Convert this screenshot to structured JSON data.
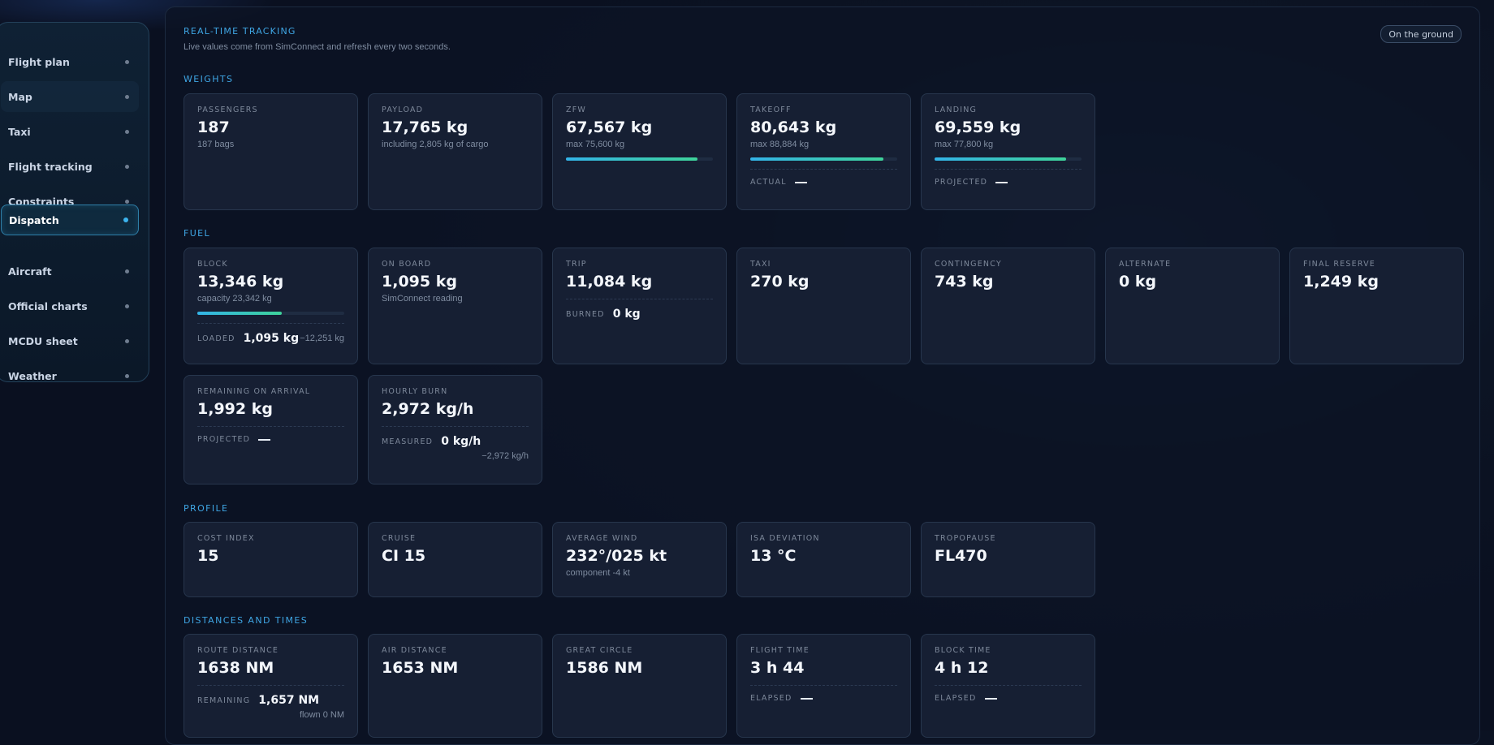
{
  "sidebar": {
    "items": [
      {
        "label": "Flight plan"
      },
      {
        "label": "Map"
      },
      {
        "label": "Taxi"
      },
      {
        "label": "Flight tracking"
      },
      {
        "label": "Constraints"
      },
      {
        "label": "Dispatch"
      },
      {
        "label": "Aircraft"
      },
      {
        "label": "Official charts"
      },
      {
        "label": "MCDU sheet"
      },
      {
        "label": "Weather"
      }
    ],
    "active": "Dispatch"
  },
  "header": {
    "title": "REAL-TIME TRACKING",
    "subtitle": "Live values come from SimConnect and refresh every two seconds.",
    "status": "On the ground"
  },
  "sections": {
    "weights": {
      "title": "WEIGHTS",
      "passengers": {
        "label": "PASSENGERS",
        "value": "187",
        "sub": "187 bags"
      },
      "payload": {
        "label": "PAYLOAD",
        "value": "17,765 kg",
        "sub": "including 2,805 kg of cargo"
      },
      "zfw": {
        "label": "ZFW",
        "value": "67,567 kg",
        "sub": "max 75,600 kg",
        "fill": 0.894
      },
      "takeoff": {
        "label": "TAKEOFF",
        "value": "80,643 kg",
        "sub": "max 88,884 kg",
        "fill": 0.907,
        "foot_label": "ACTUAL"
      },
      "landing": {
        "label": "LANDING",
        "value": "69,559 kg",
        "sub": "max 77,800 kg",
        "fill": 0.894,
        "foot_label": "PROJECTED"
      }
    },
    "fuel": {
      "title": "FUEL",
      "block": {
        "label": "BLOCK",
        "value": "13,346 kg",
        "sub": "capacity 23,342 kg",
        "fill": 0.572,
        "foot_label": "LOADED",
        "foot_value": "1,095 kg",
        "foot_extra": "−12,251 kg"
      },
      "on_board": {
        "label": "ON BOARD",
        "value": "1,095 kg",
        "sub": "SimConnect reading"
      },
      "trip": {
        "label": "TRIP",
        "value": "11,084 kg",
        "foot_label": "BURNED",
        "foot_value": "0 kg"
      },
      "taxi": {
        "label": "TAXI",
        "value": "270 kg"
      },
      "contingency": {
        "label": "CONTINGENCY",
        "value": "743 kg"
      },
      "alternate": {
        "label": "ALTERNATE",
        "value": "0 kg"
      },
      "final_reserve": {
        "label": "FINAL RESERVE",
        "value": "1,249 kg"
      },
      "remaining": {
        "label": "REMAINING ON ARRIVAL",
        "value": "1,992 kg",
        "foot_label": "PROJECTED"
      },
      "hourly": {
        "label": "HOURLY BURN",
        "value": "2,972 kg/h",
        "foot_label": "MEASURED",
        "foot_value": "0 kg/h",
        "foot_extra": "−2,972 kg/h"
      }
    },
    "profile": {
      "title": "PROFILE",
      "cost_index": {
        "label": "COST INDEX",
        "value": "15"
      },
      "cruise": {
        "label": "CRUISE",
        "value": "CI 15"
      },
      "avg_wind": {
        "label": "AVERAGE WIND",
        "value": "232°/025 kt",
        "sub": "component -4 kt"
      },
      "isa": {
        "label": "ISA DEVIATION",
        "value": "13 °C"
      },
      "tropopause": {
        "label": "TROPOPAUSE",
        "value": "FL470"
      }
    },
    "distances": {
      "title": "DISTANCES AND TIMES",
      "route": {
        "label": "ROUTE DISTANCE",
        "value": "1638 NM",
        "foot_label": "REMAINING",
        "foot_value": "1,657 NM",
        "foot_extra": "flown 0 NM"
      },
      "air": {
        "label": "AIR DISTANCE",
        "value": "1653 NM"
      },
      "great_circle": {
        "label": "GREAT CIRCLE",
        "value": "1586 NM"
      },
      "flight_time": {
        "label": "FLIGHT TIME",
        "value": "3 h 44",
        "foot_label": "ELAPSED"
      },
      "block_time": {
        "label": "BLOCK TIME",
        "value": "4 h 12",
        "foot_label": "ELAPSED"
      }
    }
  }
}
